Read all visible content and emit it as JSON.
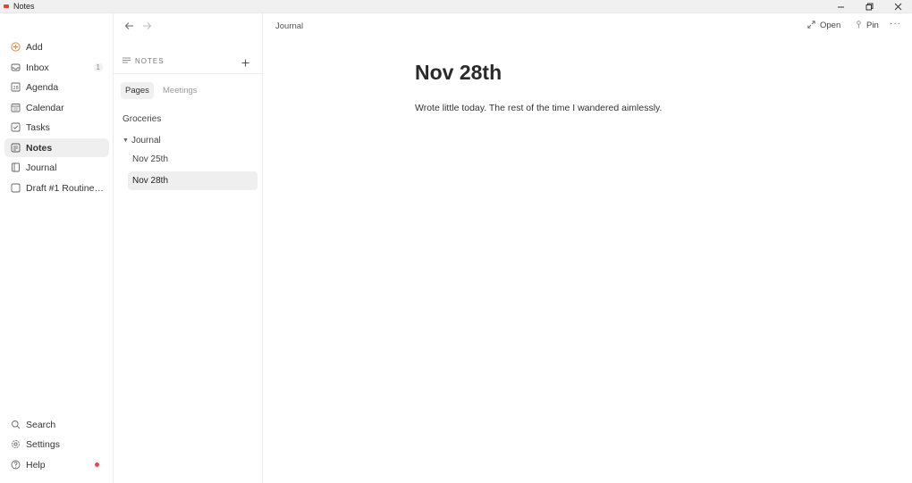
{
  "window": {
    "title": "Notes"
  },
  "sidebar": {
    "items": [
      {
        "label": "Add",
        "icon": "plus-circle-icon"
      },
      {
        "label": "Inbox",
        "icon": "inbox-icon",
        "badge": "1"
      },
      {
        "label": "Agenda",
        "icon": "agenda-icon",
        "icon_text": "28"
      },
      {
        "label": "Calendar",
        "icon": "calendar-icon"
      },
      {
        "label": "Tasks",
        "icon": "checkbox-icon"
      },
      {
        "label": "Notes",
        "icon": "note-icon",
        "active": true
      },
      {
        "label": "Journal",
        "icon": "book-icon"
      },
      {
        "label": "Draft #1 Routine r...",
        "icon": "page-icon"
      }
    ],
    "bottom": [
      {
        "label": "Search",
        "icon": "search-icon"
      },
      {
        "label": "Settings",
        "icon": "gear-icon"
      },
      {
        "label": "Help",
        "icon": "help-icon"
      }
    ]
  },
  "list": {
    "section_title": "NOTES",
    "tabs": [
      {
        "label": "Pages",
        "active": true
      },
      {
        "label": "Meetings",
        "active": false
      }
    ],
    "tree": [
      {
        "label": "Groceries"
      },
      {
        "label": "Journal",
        "expanded": true
      },
      {
        "label": "Nov 25th"
      },
      {
        "label": "Nov 28th",
        "active": true
      }
    ]
  },
  "main": {
    "breadcrumb": "Journal",
    "open_label": "Open",
    "pin_label": "Pin",
    "title": "Nov 28th",
    "body": "Wrote little today. The rest of the time I wandered aimlessly."
  },
  "colors": {
    "accent": "#e8893a",
    "help_dot": "#e5484d",
    "active_bg": "#efefef"
  }
}
